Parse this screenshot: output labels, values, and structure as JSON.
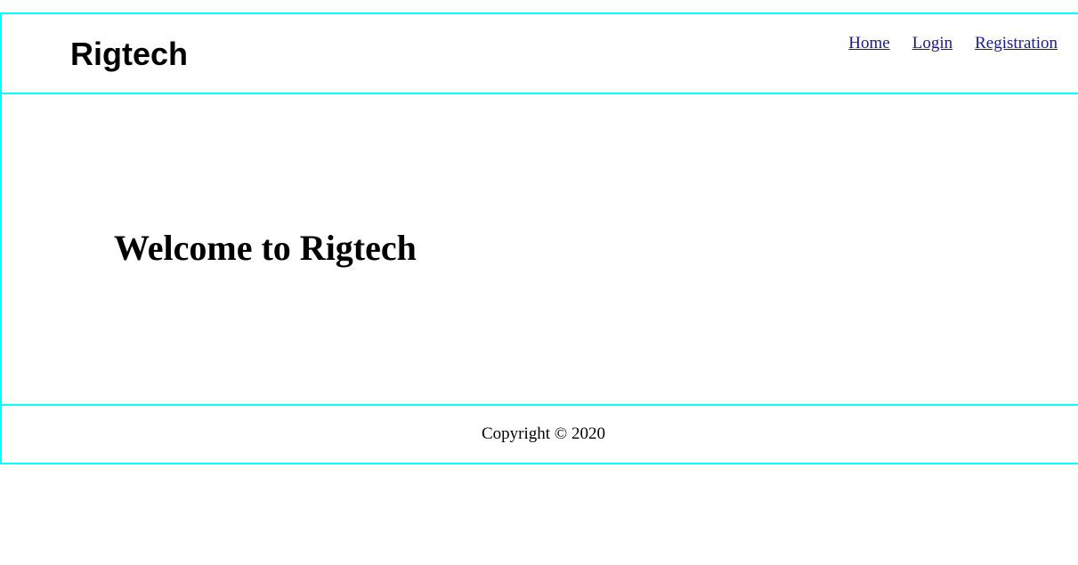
{
  "header": {
    "brand": "Rigtech",
    "nav": [
      {
        "label": "Home"
      },
      {
        "label": "Login"
      },
      {
        "label": "Registration"
      }
    ]
  },
  "main": {
    "heading": "Welcome to Rigtech"
  },
  "footer": {
    "copyright": "Copyright © 2020"
  },
  "colors": {
    "border": "#00ffff",
    "link": "#1a1a8c",
    "text": "#000000",
    "background": "#ffffff"
  }
}
